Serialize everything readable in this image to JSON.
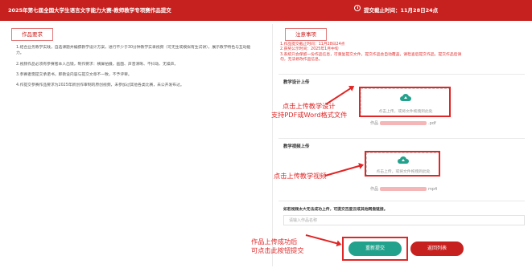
{
  "header": {
    "title": "2025年第七届全国大学生语言文字能力大赛-教师教学专项赛作品提交",
    "deadline": "提交截止时间：11月28日24点"
  },
  "requirements": {
    "heading": "作品要求",
    "items": [
      "1.结合业务教学实践，自选课题并编撰教学设计方案，进行不少于30分钟教学实录视频（可无生或模拟有生试讲），展示教学特色与互动能力。",
      "2.视频作品必须有参赛者本人出镜，制作要求：横屏拍摄，画面、声音清晰、不抖动、无噪声。",
      "3.参赛者需提交承诺书，即教设内容与提交文章不一致，不予评审。",
      "4.作提交参赛作品要求为2025年新创作审制的原创视频，未参加过其他各类比赛，未公开发布过。"
    ]
  },
  "notice": {
    "heading": "注意事项",
    "lines": [
      "1.作品提交截止时间：11月28日24点",
      "2.获奖公示时间：2025年1月中旬",
      "3.系统只会保留一份作品信息，可重复提交文件，提交作品会自动覆盖，请检查后提交作品，提交作品后请",
      "   勿，无法修改作品信息。"
    ]
  },
  "design_upload": {
    "label": "教学设计上传",
    "hint": "点击上传，或将文件拖拽到此处",
    "file_prefix": "作品",
    "file_ext": ".pdf"
  },
  "video_upload": {
    "label": "教学视频上传",
    "hint": "点击上传，或将文件拖拽到此处",
    "file_prefix": "作品",
    "file_ext": "mp4"
  },
  "fallback": {
    "label": "如若视频太大无法成功上传，可提交百度云或其他网盘链接。",
    "placeholder": "请输入作品名称"
  },
  "buttons": {
    "submit": "重新提交",
    "back": "返回列表"
  },
  "annotations": {
    "design_line1": "点击上传教学设计",
    "design_line2": "支持PDF或Word格式文件",
    "video": "点击上传教学视频",
    "submit_line1": "作品上传成功后",
    "submit_line2": "可点击此按钮提交"
  },
  "colors": {
    "brand_red": "#c7211f",
    "accent_teal": "#22a28c",
    "annotation_red": "#e02626"
  }
}
